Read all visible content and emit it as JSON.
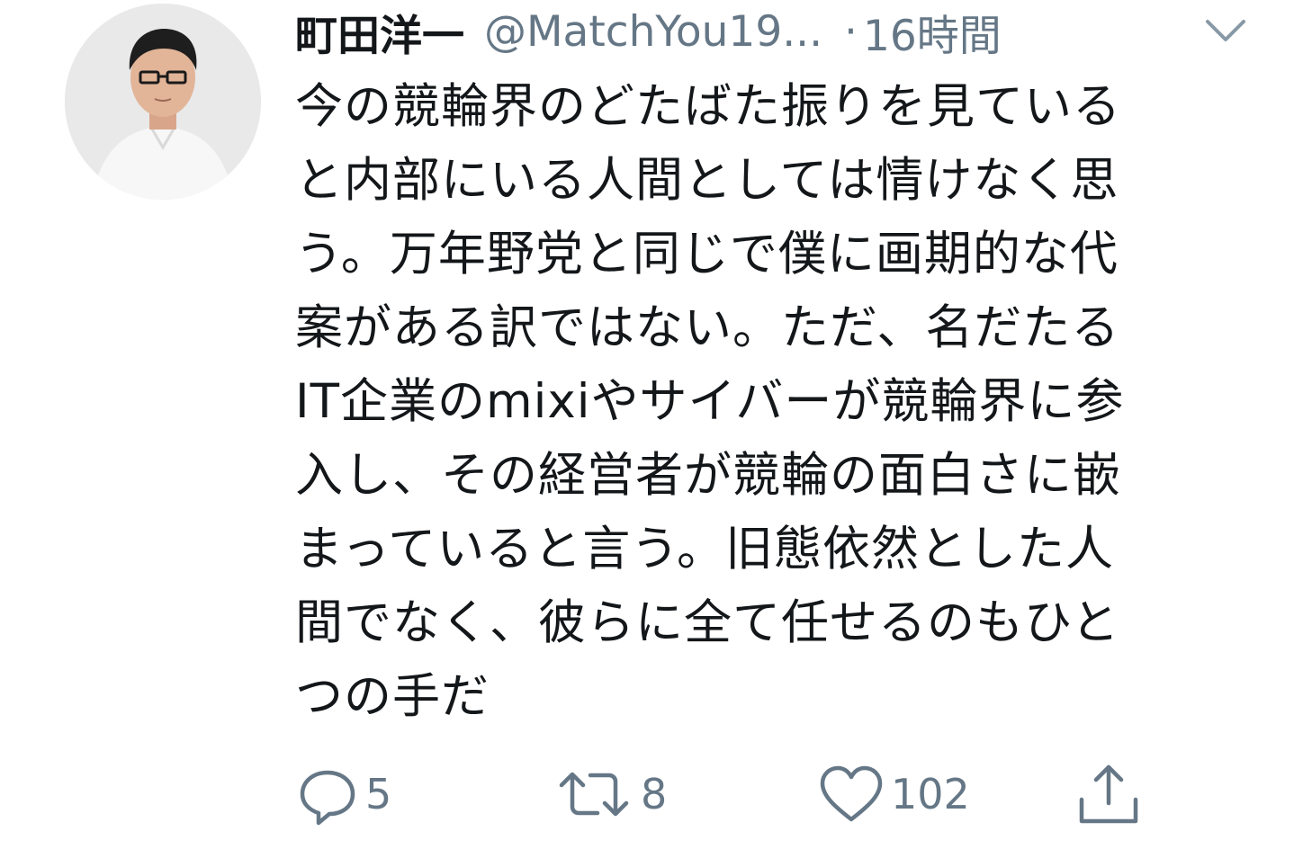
{
  "tweet": {
    "author": {
      "display_name": "町田洋一",
      "handle": "@MatchYou19..."
    },
    "separator": "·",
    "timestamp": "16時間",
    "text_lines": [
      "今の競輪界のどたばた振りを見ている",
      "と内部にいる人間としては情けなく思",
      "う。万年野党と同じで僕に画期的な代",
      "案がある訳ではない。ただ、名だたる",
      "IT企業のmixiやサイバーが競輪界に参",
      "入し、その経営者が競輪の面白さに嵌",
      "まっていると言う。旧態依然とした人",
      "間でなく、彼らに全て任せるのもひと",
      "つの手だ"
    ],
    "actions": {
      "reply_count": "5",
      "retweet_count": "8",
      "like_count": "102"
    },
    "icons": {
      "avatar": "profile-photo",
      "caret": "chevron-down-icon",
      "reply": "reply-icon",
      "retweet": "retweet-icon",
      "like": "heart-icon",
      "share": "share-icon"
    },
    "colors": {
      "text": "#14171a",
      "muted": "#657786",
      "background": "#ffffff"
    }
  }
}
